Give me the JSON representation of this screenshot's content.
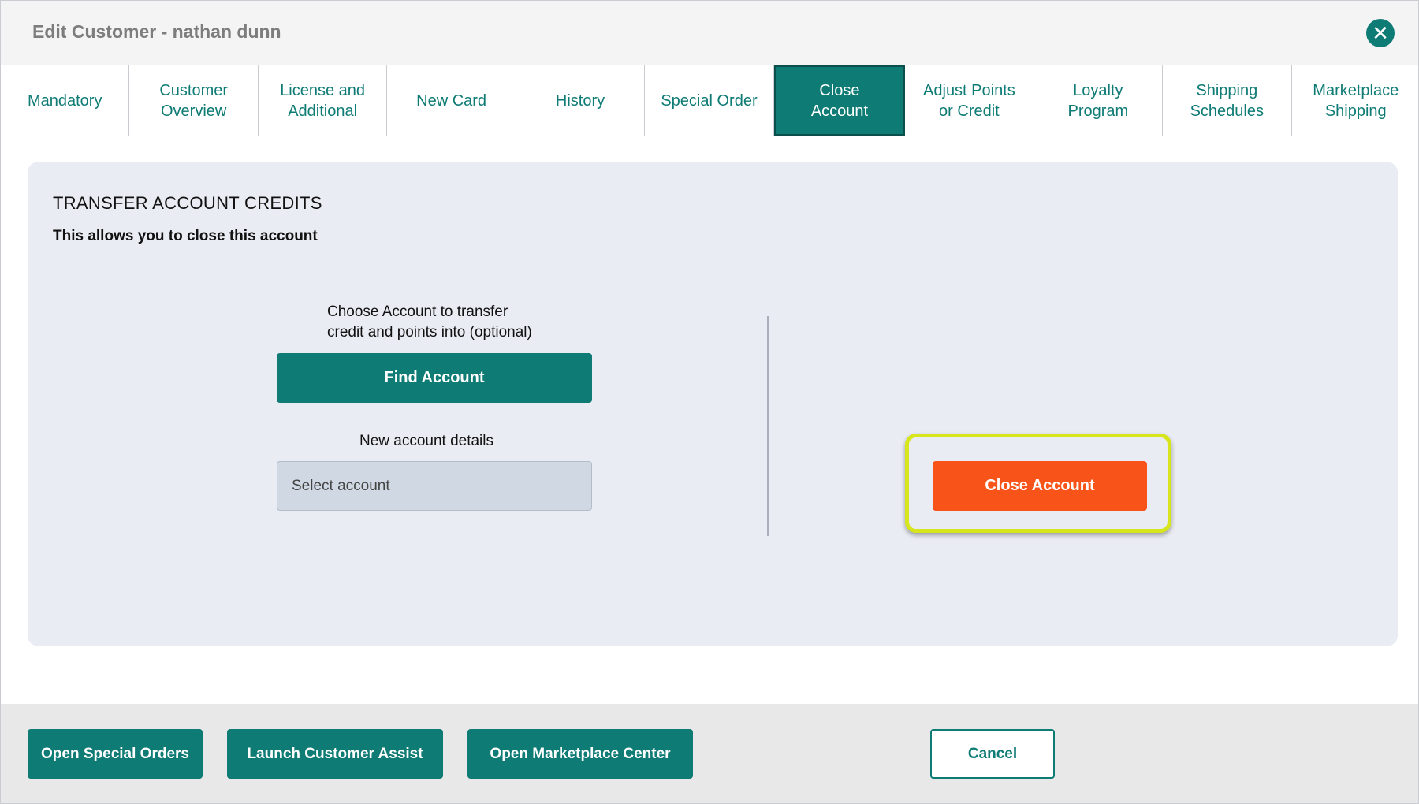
{
  "dialog": {
    "title": "Edit Customer - nathan dunn",
    "close_icon": "close-icon"
  },
  "tabs": [
    {
      "label": "Mandatory",
      "active": false
    },
    {
      "label": "Customer\nOverview",
      "active": false
    },
    {
      "label": "License and\nAdditional",
      "active": false
    },
    {
      "label": "New Card",
      "active": false
    },
    {
      "label": "History",
      "active": false
    },
    {
      "label": "Special Order",
      "active": false
    },
    {
      "label": "Close\nAccount",
      "active": true
    },
    {
      "label": "Adjust Points\nor Credit",
      "active": false
    },
    {
      "label": "Loyalty\nProgram",
      "active": false
    },
    {
      "label": "Shipping\nSchedules",
      "active": false
    },
    {
      "label": "Marketplace\nShipping",
      "active": false
    }
  ],
  "panel": {
    "title": "TRANSFER ACCOUNT CREDITS",
    "subtitle": "This allows you to close this account",
    "choose_label": "Choose Account to transfer\ncredit and points into (optional)",
    "find_button": "Find Account",
    "new_details_label": "New account details",
    "select_placeholder": "Select account",
    "close_button": "Close Account"
  },
  "footer": {
    "open_special_orders": "Open Special Orders",
    "launch_customer_assist": "Launch Customer Assist",
    "open_marketplace_center": "Open Marketplace Center",
    "cancel": "Cancel"
  },
  "colors": {
    "brand_teal": "#0f7b75",
    "danger_orange": "#f85419",
    "highlight_yellow": "#d6e51c",
    "panel_bg": "#e9ecf2"
  }
}
